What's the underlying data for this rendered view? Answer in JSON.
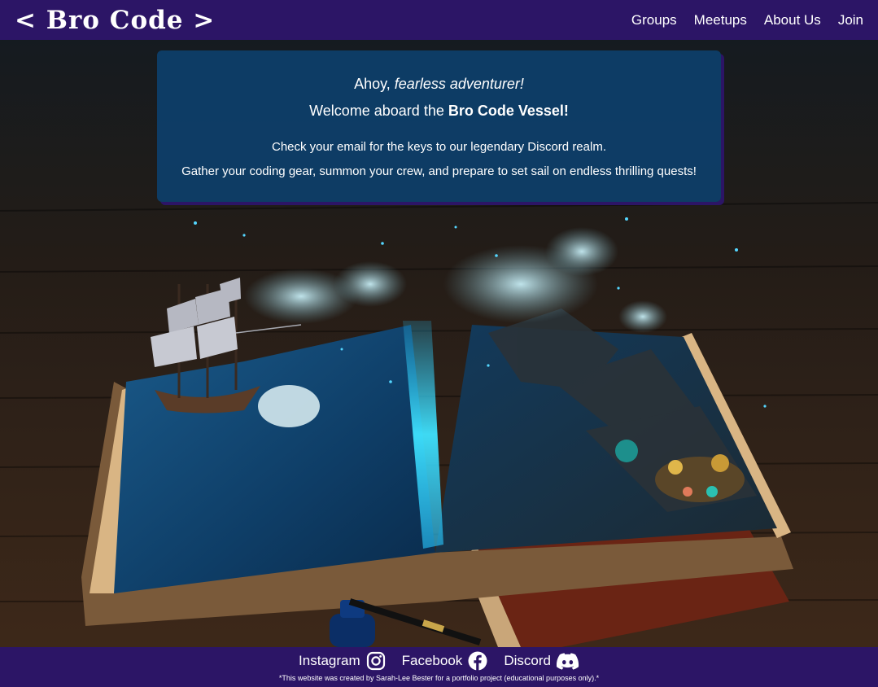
{
  "header": {
    "brand": "< Bro Code >",
    "nav": [
      "Groups",
      "Meetups",
      "About Us",
      "Join"
    ]
  },
  "welcome": {
    "greeting_prefix": "Ahoy, ",
    "greeting_emphasis": "fearless adventurer!",
    "welcome_prefix": "Welcome aboard the ",
    "welcome_strong": "Bro Code Vessel!",
    "line3": "Check your email for the keys to our legendary Discord realm.",
    "line4": "Gather your coding gear, summon your crew, and prepare to set sail on endless thrilling quests!"
  },
  "footer": {
    "links": [
      {
        "label": "Instagram",
        "icon": "instagram-icon"
      },
      {
        "label": "Facebook",
        "icon": "facebook-icon"
      },
      {
        "label": "Discord",
        "icon": "discord-icon"
      }
    ],
    "credit": "*This website was created by Sarah-Lee Bester for a portfolio project (educational purposes only).*"
  },
  "colors": {
    "bar": "#2c1566",
    "card": "#0d3e6b",
    "text": "#ffffff"
  }
}
